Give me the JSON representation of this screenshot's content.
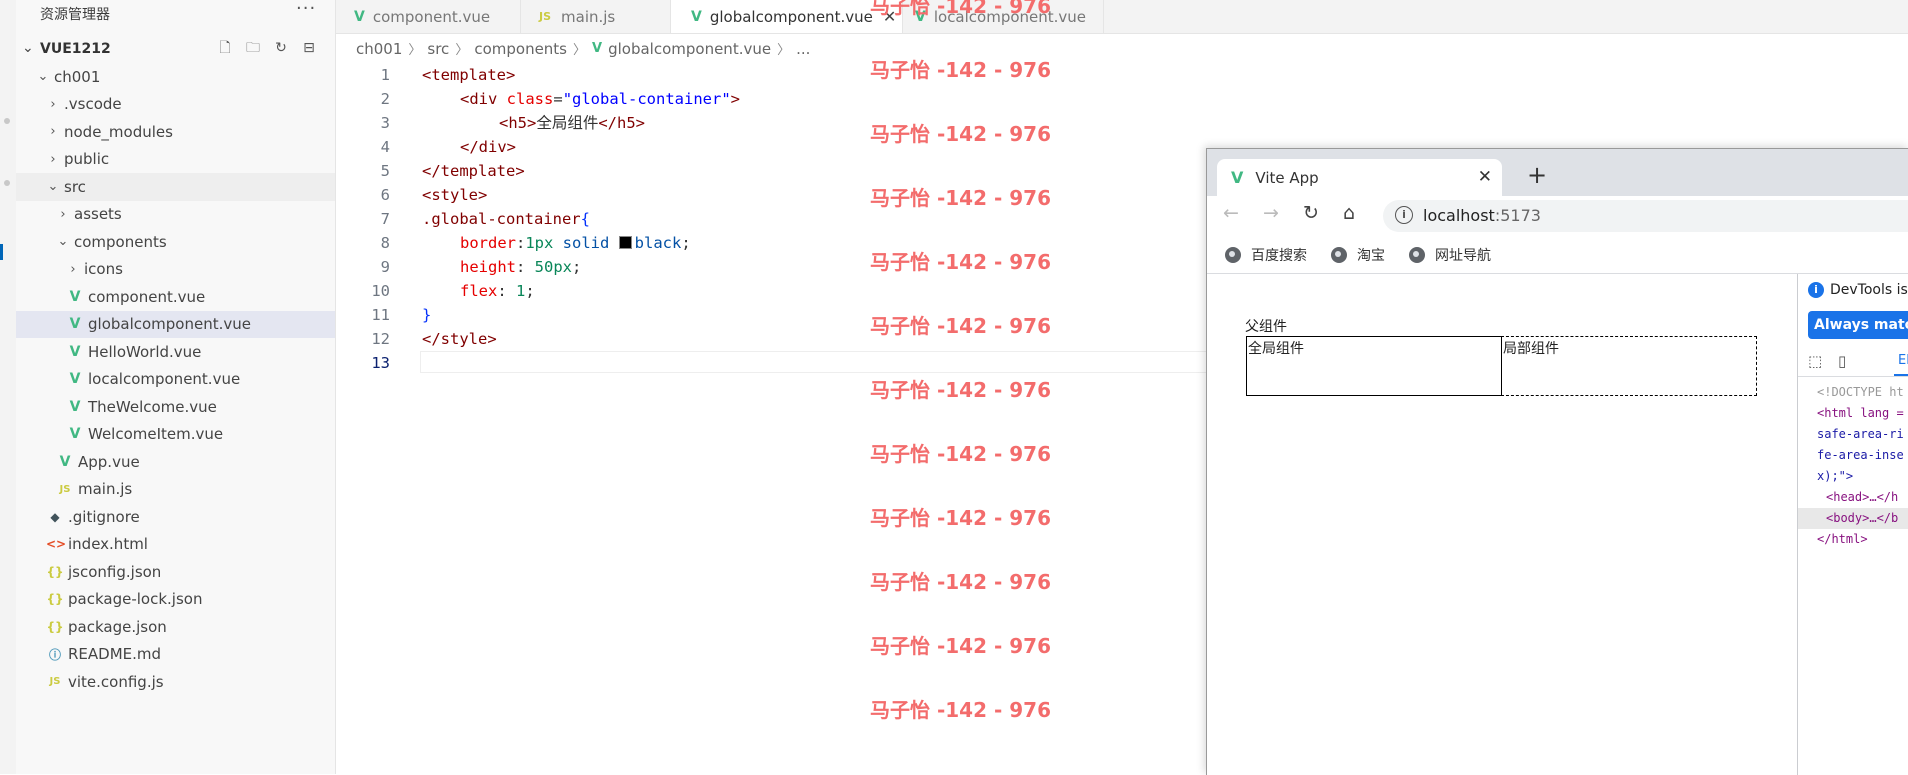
{
  "sidebar": {
    "title": "资源管理器",
    "more": "···",
    "root": "VUE1212",
    "tree": [
      {
        "label": "ch001",
        "type": "folder-open",
        "depth": 0
      },
      {
        "label": ".vscode",
        "type": "folder",
        "depth": 1
      },
      {
        "label": "node_modules",
        "type": "folder",
        "depth": 1
      },
      {
        "label": "public",
        "type": "folder",
        "depth": 1
      },
      {
        "label": "src",
        "type": "folder-open",
        "depth": 1
      },
      {
        "label": "assets",
        "type": "folder",
        "depth": 2
      },
      {
        "label": "components",
        "type": "folder-open",
        "depth": 2
      },
      {
        "label": "icons",
        "type": "folder",
        "depth": 3
      },
      {
        "label": "component.vue",
        "type": "vue",
        "depth": 3
      },
      {
        "label": "globalcomponent.vue",
        "type": "vue",
        "depth": 3
      },
      {
        "label": "HelloWorld.vue",
        "type": "vue",
        "depth": 3
      },
      {
        "label": "localcomponent.vue",
        "type": "vue",
        "depth": 3
      },
      {
        "label": "TheWelcome.vue",
        "type": "vue",
        "depth": 3
      },
      {
        "label": "WelcomeItem.vue",
        "type": "vue",
        "depth": 3
      },
      {
        "label": "App.vue",
        "type": "vue",
        "depth": 2
      },
      {
        "label": "main.js",
        "type": "js",
        "depth": 2
      },
      {
        "label": ".gitignore",
        "type": "git",
        "depth": 1
      },
      {
        "label": "index.html",
        "type": "html",
        "depth": 1
      },
      {
        "label": "jsconfig.json",
        "type": "json",
        "depth": 1
      },
      {
        "label": "package-lock.json",
        "type": "json",
        "depth": 1
      },
      {
        "label": "package.json",
        "type": "json",
        "depth": 1
      },
      {
        "label": "README.md",
        "type": "info",
        "depth": 1
      },
      {
        "label": "vite.config.js",
        "type": "js",
        "depth": 1
      }
    ]
  },
  "tabs": [
    {
      "label": "component.vue",
      "icon": "vue"
    },
    {
      "label": "main.js",
      "icon": "JS"
    },
    {
      "label": "globalcomponent.vue",
      "icon": "vue",
      "active": true
    },
    {
      "label": "localcomponent.vue",
      "icon": "vue"
    }
  ],
  "breadcrumb": [
    "ch001",
    "src",
    "components",
    "globalcomponent.vue",
    "..."
  ],
  "code": {
    "lines": [
      "1",
      "2",
      "3",
      "4",
      "5",
      "6",
      "7",
      "8",
      "9",
      "10",
      "11",
      "12",
      "13"
    ],
    "l1": "<template>",
    "l2_open": "<div ",
    "l2_attr": "class",
    "l2_val": "\"global-container\"",
    "l2_close": ">",
    "l3_open": "<h5>",
    "l3_text": "全局组件",
    "l3_close": "</h5>",
    "l4": "</div>",
    "l5": "</template>",
    "l6": "<style>",
    "l7_sel": ".global-container",
    "l7_brace": "{",
    "l8_prop": "border",
    "l8_val1": "1px",
    "l8_val2": " solid ",
    "l8_val3": "black",
    "l9_prop": "height",
    "l9_val": "50px",
    "l10_prop": "flex",
    "l10_val": "1",
    "l11": "}",
    "l12": "</style>"
  },
  "watermark": "马子怡 -142 - 976",
  "browser": {
    "tab_title": "Vite App",
    "url_host": "localhost",
    "url_port": ":5173",
    "bookmarks": [
      "百度搜索",
      "淘宝",
      "网址导航"
    ],
    "page": {
      "parent_label": "父组件",
      "global_label": "全局组件",
      "local_label": "局部组件"
    },
    "devtools": {
      "info": "DevTools is",
      "button": "Always match",
      "tab": "El",
      "code": [
        "<!DOCTYPE ht",
        "<html lang =",
        "safe-area-ri",
        "fe-area-inse",
        "x);\">",
        "<head>…</h",
        "<body>…</b",
        "</html>"
      ]
    }
  }
}
